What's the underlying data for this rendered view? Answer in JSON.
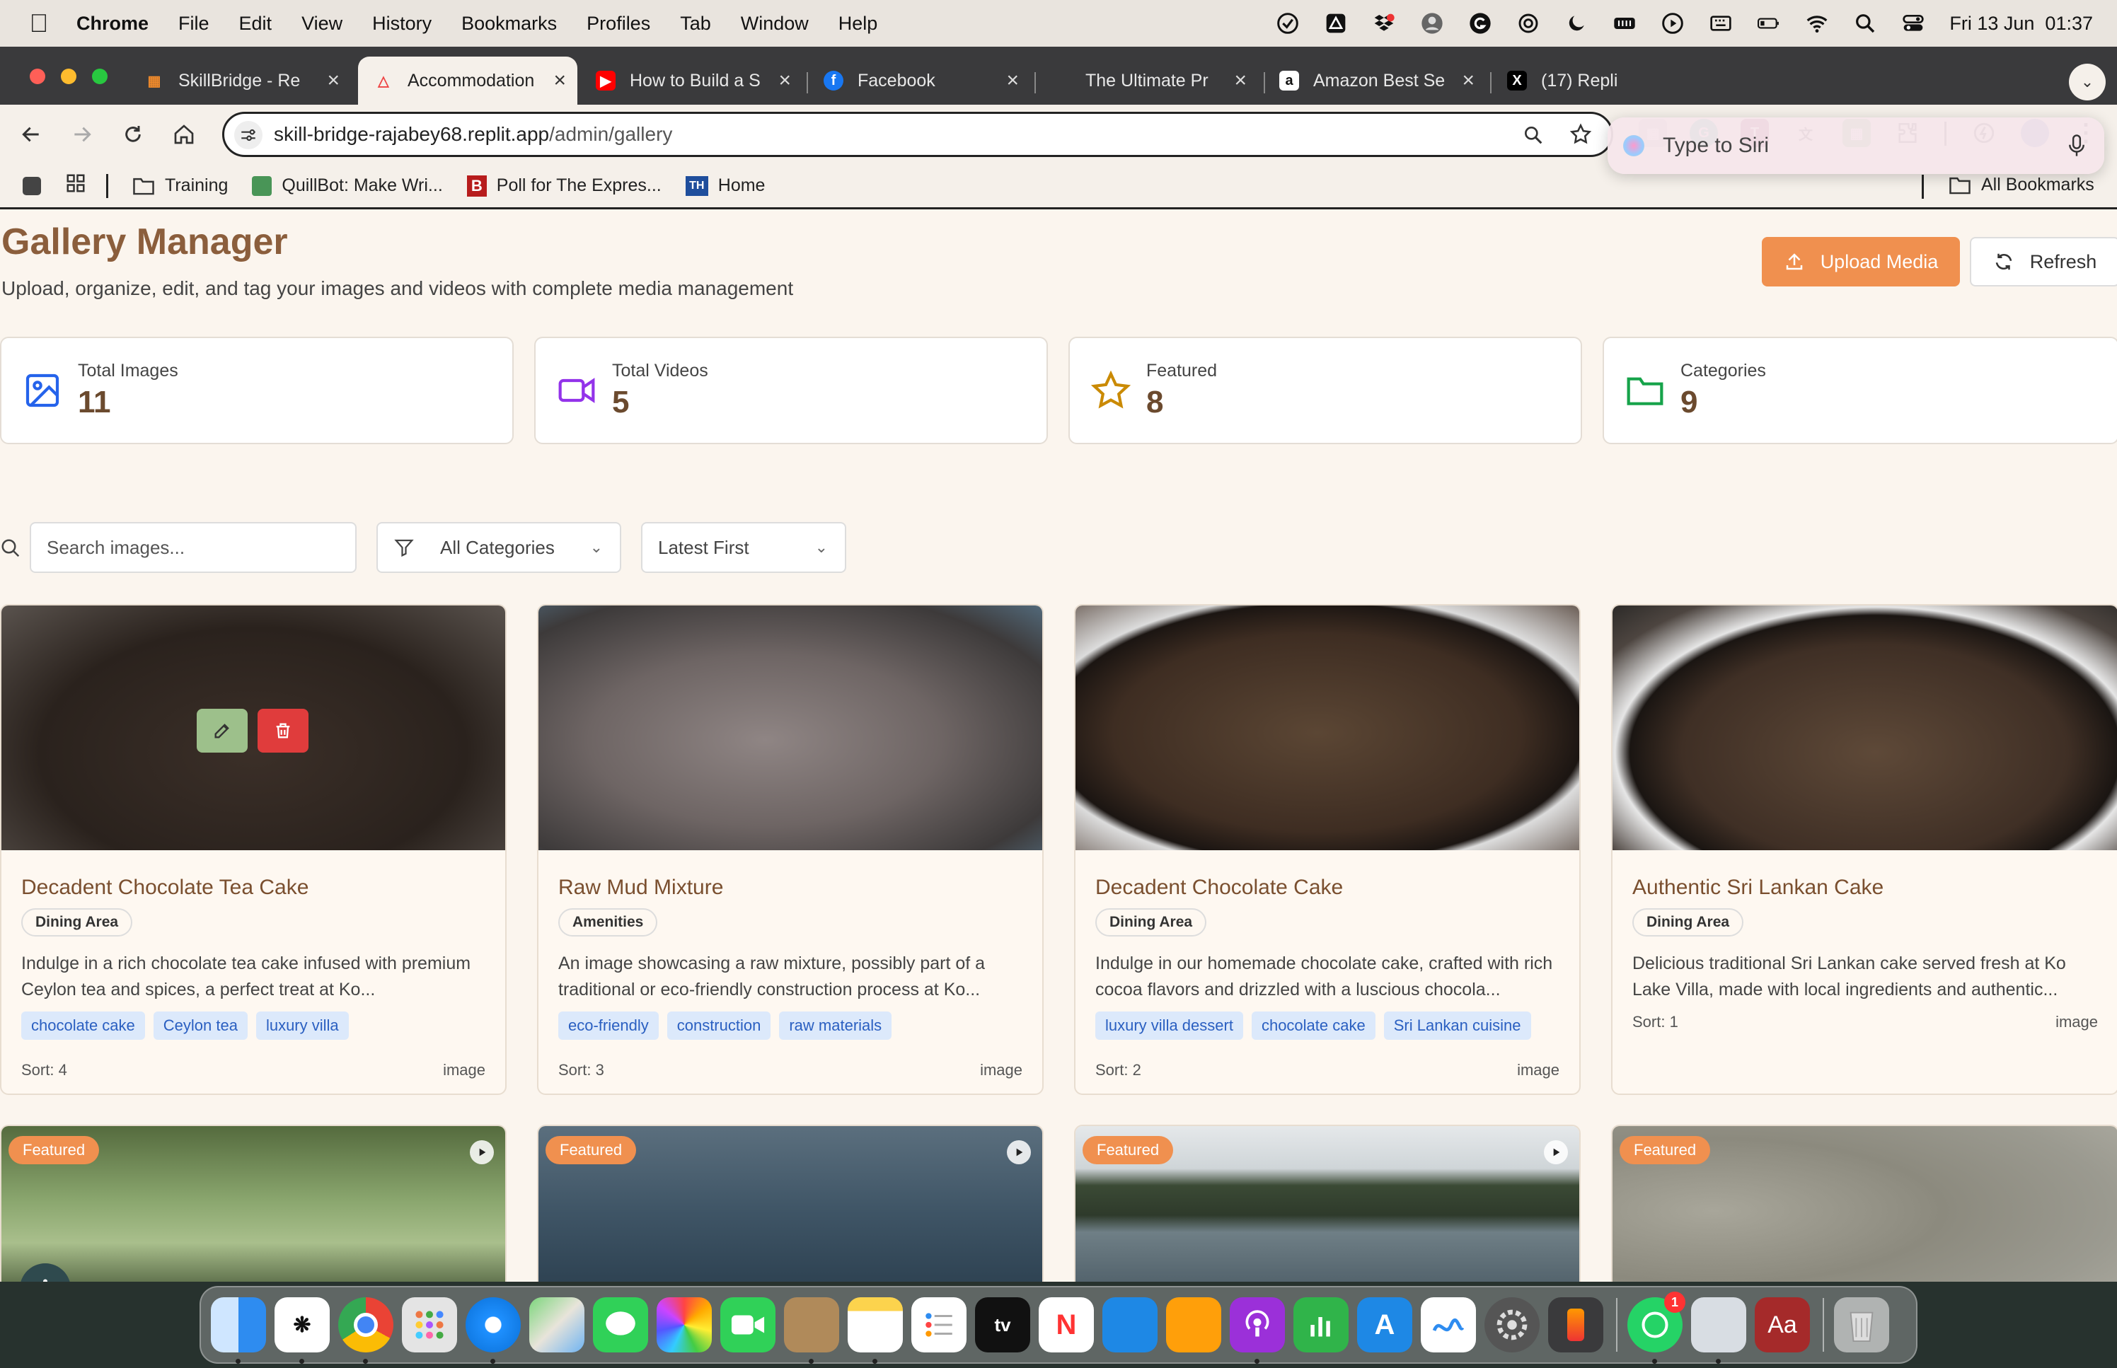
{
  "menubar": {
    "app": "Chrome",
    "items": [
      "File",
      "Edit",
      "View",
      "History",
      "Bookmarks",
      "Profiles",
      "Tab",
      "Window",
      "Help"
    ],
    "clock": "Fri 13 Jun  01:37"
  },
  "tabs": [
    {
      "title": "SkillBridge - Re",
      "active": false
    },
    {
      "title": "Accommodation",
      "active": true
    },
    {
      "title": "How to Build a S",
      "active": false
    },
    {
      "title": "Facebook",
      "active": false
    },
    {
      "title": "The Ultimate Pr",
      "active": false
    },
    {
      "title": "Amazon Best Se",
      "active": false
    },
    {
      "title": "(17) Repli",
      "active": false
    }
  ],
  "address": {
    "host": "skill-bridge-rajabey68.replit.app",
    "path": "/admin/gallery"
  },
  "bookmarks": {
    "items": [
      "Training",
      "QuillBot: Make Wri...",
      "Poll for The Expres...",
      "Home"
    ],
    "all": "All Bookmarks"
  },
  "siri": {
    "placeholder": "Type to Siri"
  },
  "page": {
    "title": "Gallery Manager",
    "subtitle": "Upload, organize, edit, and tag your images and videos with complete media management",
    "upload_label": "Upload Media",
    "refresh_label": "Refresh"
  },
  "stats": [
    {
      "label": "Total Images",
      "value": "11",
      "icon": "image-icon",
      "color": "#2563eb"
    },
    {
      "label": "Total Videos",
      "value": "5",
      "icon": "video-icon",
      "color": "#9333ea"
    },
    {
      "label": "Featured",
      "value": "8",
      "icon": "star-icon",
      "color": "#ca8a04"
    },
    {
      "label": "Categories",
      "value": "9",
      "icon": "folder-icon",
      "color": "#16a34a"
    }
  ],
  "filters": {
    "search_placeholder": "Search images...",
    "category": "All Categories",
    "sort": "Latest First"
  },
  "cards": [
    {
      "title": "Decadent Chocolate Tea Cake",
      "category": "Dining Area",
      "description": "Indulge in a rich chocolate tea cake infused with premium Ceylon tea and spices, a perfect treat at Ko...",
      "tags": [
        "chocolate cake",
        "Ceylon tea",
        "luxury villa"
      ],
      "sort": "Sort: 4",
      "type": "image"
    },
    {
      "title": "Raw Mud Mixture",
      "category": "Amenities",
      "description": "An image showcasing a raw mixture, possibly part of a traditional or eco-friendly construction process at Ko...",
      "tags": [
        "eco-friendly",
        "construction",
        "raw materials"
      ],
      "sort": "Sort: 3",
      "type": "image"
    },
    {
      "title": "Decadent Chocolate Cake",
      "category": "Dining Area",
      "description": "Indulge in our homemade chocolate cake, crafted with rich cocoa flavors and drizzled with a luscious chocola...",
      "tags": [
        "luxury villa dessert",
        "chocolate cake",
        "Sri Lankan cuisine"
      ],
      "sort": "Sort: 2",
      "type": "image"
    },
    {
      "title": "Authentic Sri Lankan Cake",
      "category": "Dining Area",
      "description": "Delicious traditional Sri Lankan cake served fresh at Ko Lake Villa, made with local ingredients and authentic...",
      "tags": [],
      "sort": "Sort: 1",
      "type": "image"
    }
  ],
  "featured_label": "Featured",
  "colors": {
    "accent": "#f0904f",
    "title_brown": "#8b5e3c",
    "tag_blue": "#2a5fc1"
  },
  "dock": {
    "whatsapp_badge": "1"
  }
}
